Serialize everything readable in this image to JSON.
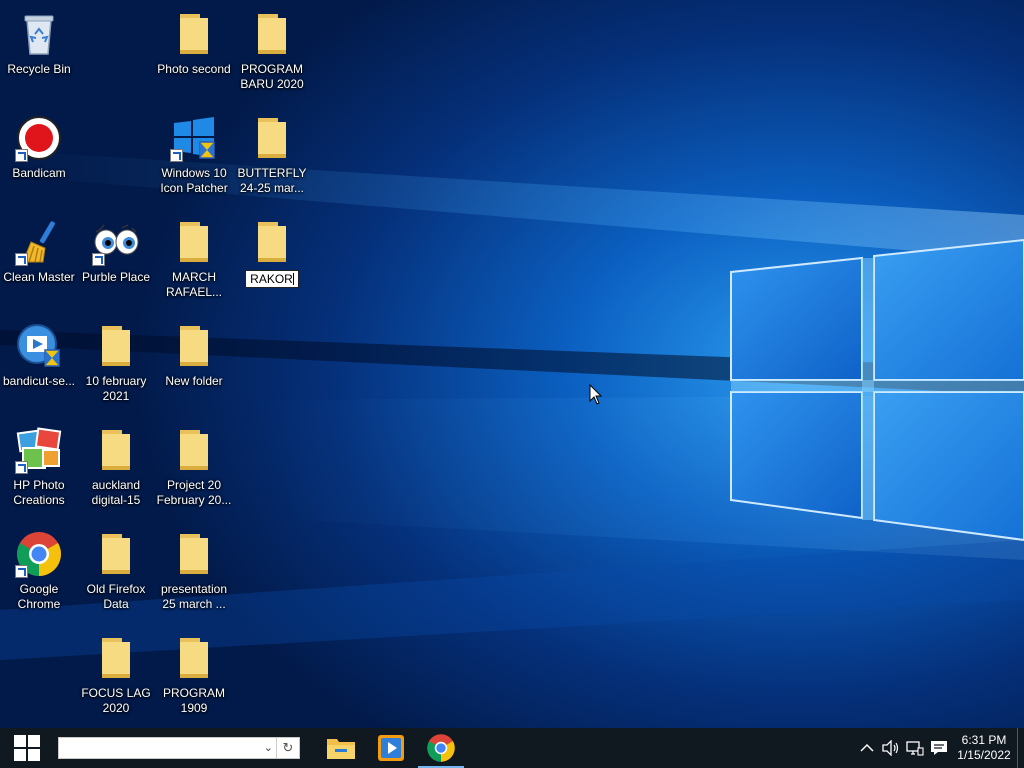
{
  "desktop": {
    "icons": [
      {
        "label": "Recycle Bin",
        "icon": "recycle-bin-icon"
      },
      {
        "label": "Bandicam",
        "icon": "bandicam-icon"
      },
      {
        "label": "Clean Master",
        "icon": "broom-icon"
      },
      {
        "label": "bandicut-se...",
        "icon": "bandicut-icon"
      },
      {
        "label": "HP Photo Creations",
        "icon": "hp-photo-icon"
      },
      {
        "label": "Google Chrome",
        "icon": "chrome-icon"
      },
      {
        "label": "Purble Place",
        "icon": "eyes-icon"
      },
      {
        "label": "10 february 2021",
        "icon": "folder-icon"
      },
      {
        "label": "auckland digital-15",
        "icon": "folder-icon"
      },
      {
        "label": "Old Firefox Data",
        "icon": "folder-icon"
      },
      {
        "label": "FOCUS LAG 2020",
        "icon": "folder-icon"
      },
      {
        "label": "Photo second",
        "icon": "folder-icon"
      },
      {
        "label": "Windows 10 Icon Patcher",
        "icon": "windows-patcher-icon"
      },
      {
        "label": "MARCH RAFAEL...",
        "icon": "folder-icon"
      },
      {
        "label": "New folder",
        "icon": "folder-icon"
      },
      {
        "label": "Project 20 February 20...",
        "icon": "folder-icon"
      },
      {
        "label": "presentation 25 march ...",
        "icon": "folder-icon"
      },
      {
        "label": "PROGRAM 1909",
        "icon": "folder-icon"
      },
      {
        "label": "PROGRAM BARU 2020",
        "icon": "folder-icon"
      },
      {
        "label": "BUTTERFLY 24-25 mar...",
        "icon": "folder-icon"
      },
      {
        "label": "RAKOR",
        "icon": "folder-icon",
        "renaming": true
      }
    ]
  },
  "taskbar": {
    "search": {
      "value": "",
      "placeholder": ""
    },
    "apps": [
      {
        "name": "File Explorer",
        "icon": "file-explorer-icon"
      },
      {
        "name": "Media Player",
        "icon": "media-player-icon"
      },
      {
        "name": "Google Chrome",
        "icon": "chrome-icon",
        "active": true
      }
    ],
    "tray": {
      "icons": [
        "chevron-up-icon",
        "volume-icon",
        "network-icon",
        "notification-icon"
      ],
      "time": "6:31 PM",
      "date": "1/15/2022"
    }
  },
  "colors": {
    "wallpaper_dark": "#021a4a",
    "wallpaper_light": "#1f8fe8",
    "taskbar": "#101820",
    "folder": "#f5d67a"
  }
}
